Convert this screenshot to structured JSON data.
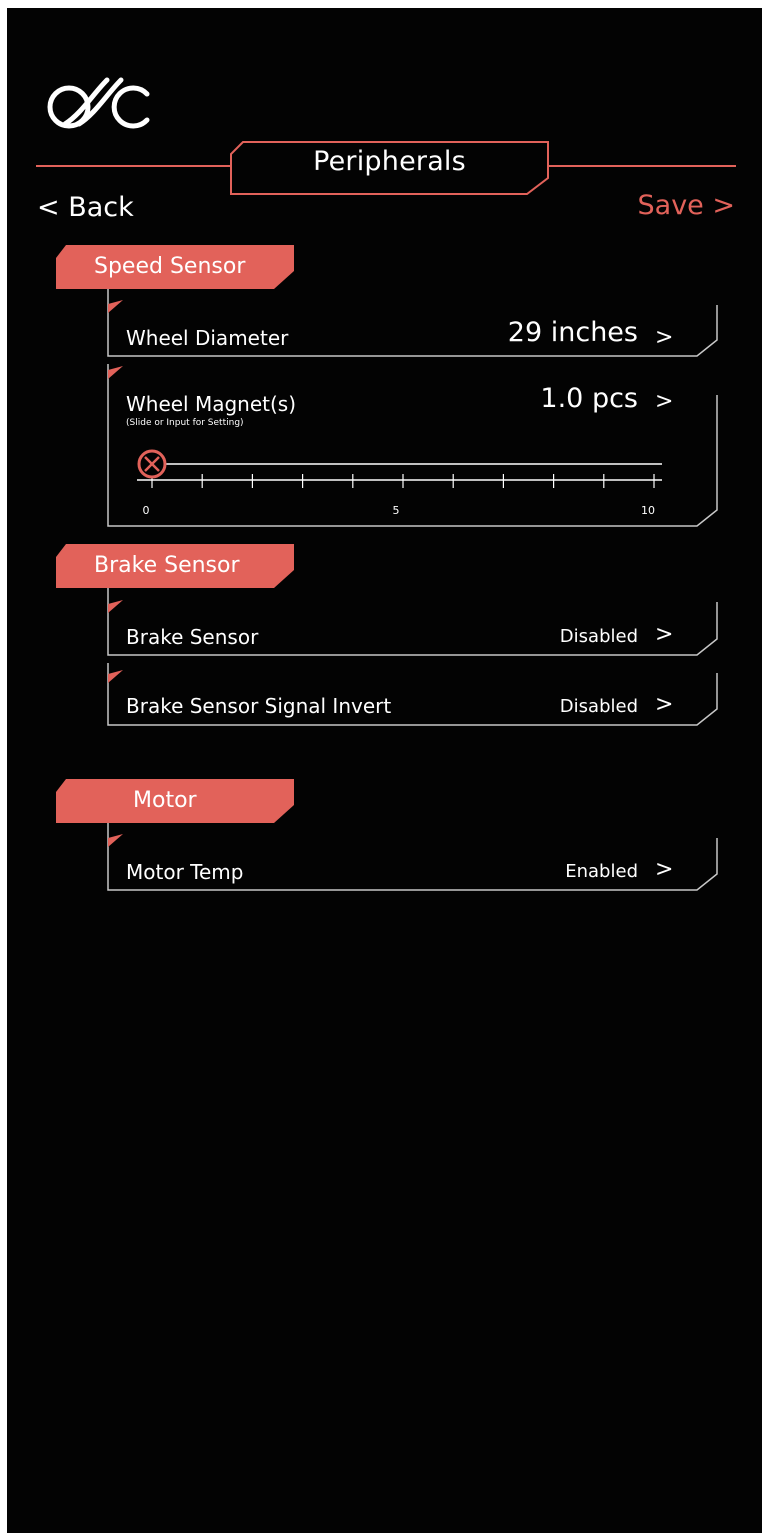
{
  "header": {
    "title": "Peripherals",
    "back_label": "< Back",
    "save_label": "Save >",
    "logo_icon": "bike-logo-icon"
  },
  "colors": {
    "accent": "#e2625a",
    "background": "#030303",
    "line": "#c8c8c8"
  },
  "sections": {
    "speed_sensor": {
      "title": "Speed Sensor",
      "wheel_diameter": {
        "label": "Wheel Diameter",
        "value": "29 inches",
        "chevron": ">"
      },
      "wheel_magnets": {
        "label": "Wheel Magnet(s)",
        "hint": "(Slide or Input for Setting)",
        "value": "1.0 pcs",
        "chevron": ">",
        "slider": {
          "min": 0,
          "max": 10,
          "current": 0,
          "labels": [
            "0",
            "5",
            "10"
          ]
        }
      }
    },
    "brake_sensor": {
      "title": "Brake Sensor",
      "brake_sensor": {
        "label": "Brake Sensor",
        "value": "Disabled",
        "chevron": ">"
      },
      "signal_invert": {
        "label": "Brake Sensor Signal Invert",
        "value": "Disabled",
        "chevron": ">"
      }
    },
    "motor": {
      "title": "Motor",
      "motor_temp": {
        "label": "Motor Temp",
        "value": "Enabled",
        "chevron": ">"
      }
    }
  }
}
